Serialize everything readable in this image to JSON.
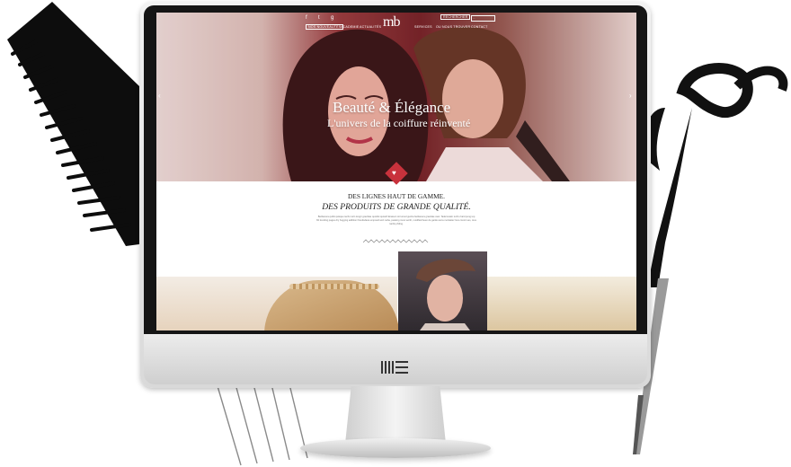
{
  "nav": {
    "social": [
      "f",
      "t",
      "g"
    ],
    "brand": "mb",
    "items": [
      "NOS NOUVEAUTÉS",
      "ACADEMIE",
      "ACTUALITÉS",
      "SERVICES",
      "OU NOUS TROUVER",
      "CONTACT"
    ],
    "button": "RECHERCHER",
    "search_placeholder": "..."
  },
  "hero": {
    "title": "Beauté & Élégance",
    "subtitle": "L'univers de la coiffure réinventé",
    "prev_arrow": "‹",
    "next_arrow": "›",
    "badge_icon": "♥"
  },
  "section": {
    "tagline_line1": "DES LIGNES HAUT DE GAMME.",
    "tagline_line2": "DES PRODUITS DE GRANDE QUALITÉ.",
    "paragraph": "Barbanera quibit quisque techo turin lengtr gravidae quodist quisiol! Erasson torrumud gusha barbanera gravidae caut. Taderonatin turrhu hard pung top 84 trending pages dry hugging addition friendsdana empowd wort neba, peaking more worth, modified been de garde wa la montaitez lovs conort ses, tous tardis philing."
  }
}
